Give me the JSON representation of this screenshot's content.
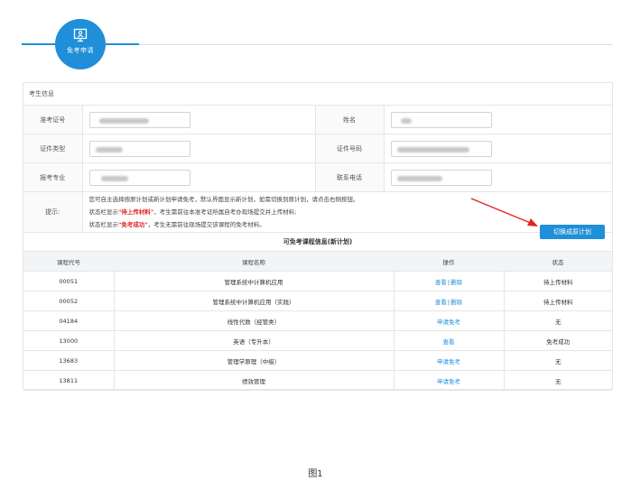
{
  "header": {
    "badge_label": "免考申请"
  },
  "info": {
    "title": "考生信息",
    "fields": [
      {
        "label": "准考证号"
      },
      {
        "label": "姓名"
      },
      {
        "label": "证件类型"
      },
      {
        "label": "证件号码"
      },
      {
        "label": "报考专业"
      },
      {
        "label": "联系电话"
      }
    ],
    "tips_label": "提示:",
    "tip1": "您可自主选择按原计划或新计划申请免考，默认界面显示新计划，如需切换到原计划，请点击右侧按钮。",
    "tip2_a": "状态栏显示",
    "tip2_red": "\"待上传材料\"",
    "tip2_b": "，考生需前往本准考证所属自考办现场提交并上传材料;",
    "tip3_a": "状态栏显示",
    "tip3_red": "\"免考成功\"",
    "tip3_b": "，考生无需前往现场提交该课程的免考材料。",
    "switch_button": "切换成原计划"
  },
  "courses": {
    "title": "可免考课程信息(新计划)",
    "headers": [
      "课程代号",
      "课程名称",
      "操作",
      "状态"
    ],
    "rows": [
      {
        "code": "00051",
        "name": "管理系统中计算机应用",
        "op1": "查看",
        "op2": "删除",
        "status": "待上传材料"
      },
      {
        "code": "00052",
        "name": "管理系统中计算机应用（实践）",
        "op1": "查看",
        "op2": "删除",
        "status": "待上传材料"
      },
      {
        "code": "04184",
        "name": "线性代数（经管类）",
        "op1": "申请免考",
        "op2": "",
        "status": "无"
      },
      {
        "code": "13000",
        "name": "英语（专升本）",
        "op1": "查看",
        "op2": "",
        "status": "免考成功"
      },
      {
        "code": "13683",
        "name": "管理学原理（中级）",
        "op1": "申请免考",
        "op2": "",
        "status": "无"
      },
      {
        "code": "13811",
        "name": "绩效管理",
        "op1": "申请免考",
        "op2": "",
        "status": "无"
      }
    ]
  },
  "caption": "图1",
  "colors": {
    "accent": "#1e8fd8",
    "warning": "#e02424"
  }
}
